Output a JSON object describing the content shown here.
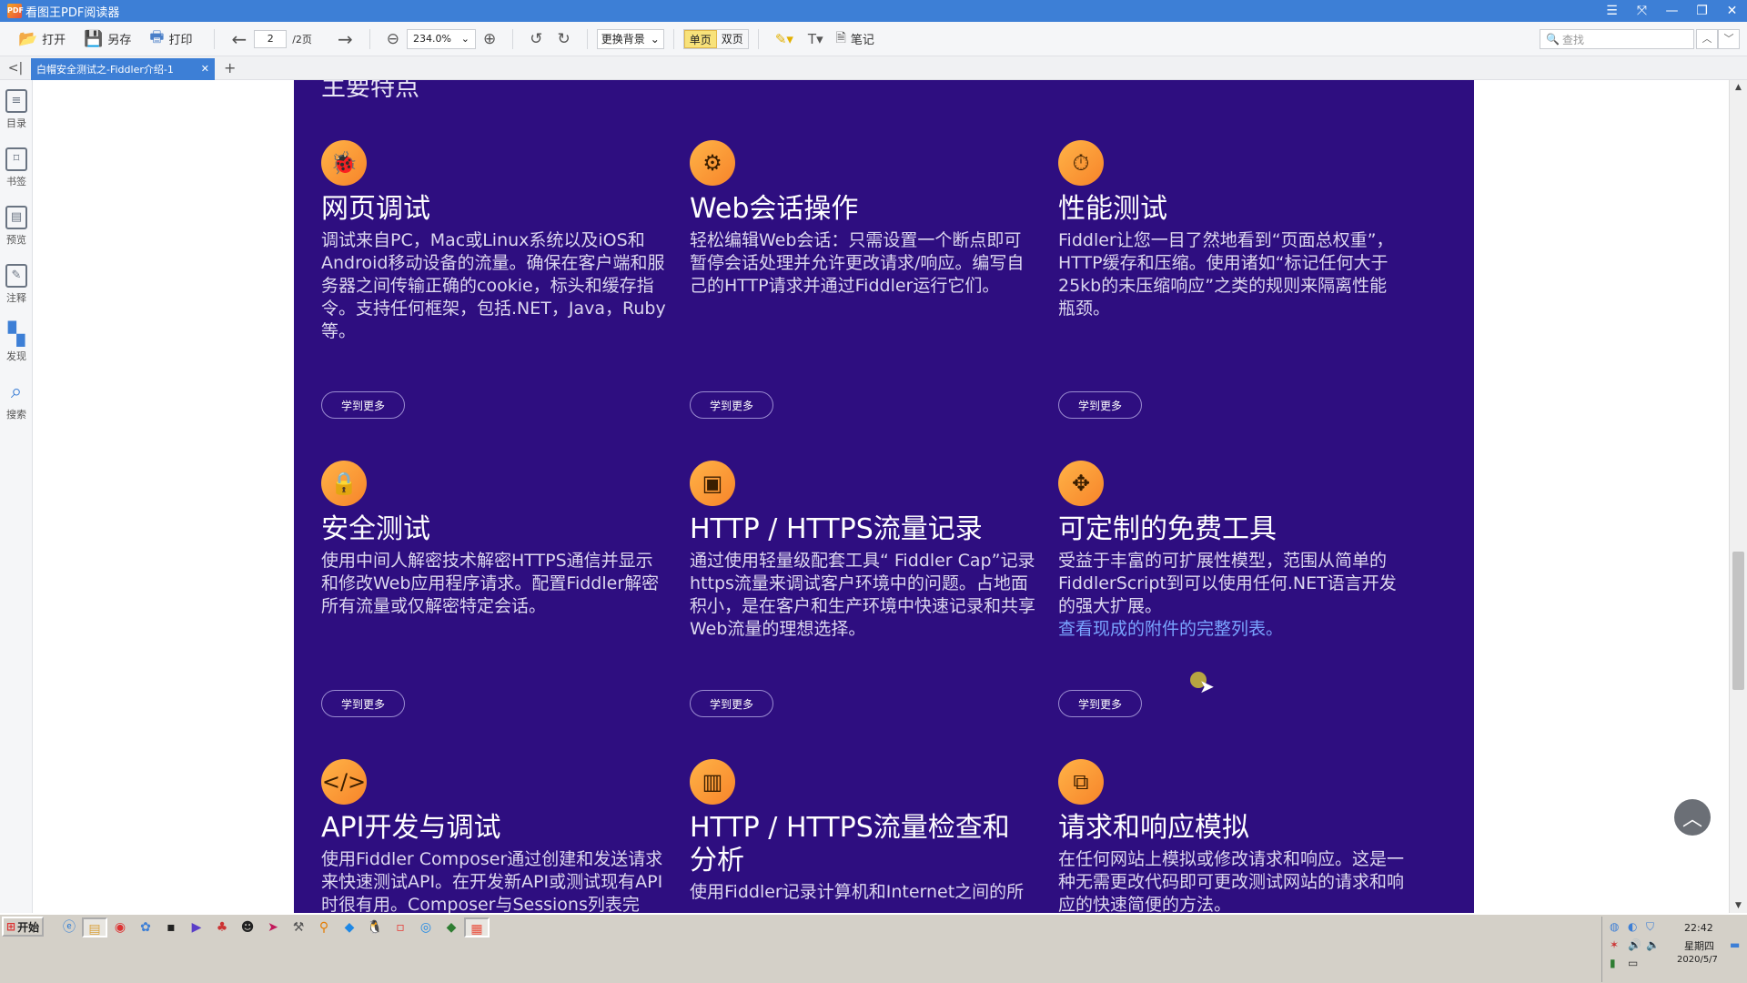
{
  "window": {
    "title": "看图王PDF阅读器",
    "app_icon": "PDF",
    "controls": [
      "menu-icon",
      "fullscreen-icon",
      "minimize-icon",
      "restore-icon",
      "close-icon"
    ]
  },
  "toolbar": {
    "open_label": "打开",
    "saveas_label": "另存",
    "print_label": "打印",
    "page_current": "2",
    "page_total": "/2页",
    "zoom_value": "234.0%",
    "background_label": "更换背景",
    "single_label": "单页",
    "double_label": "双页",
    "notes_label": "笔记",
    "search_placeholder": "查找"
  },
  "tabs": {
    "doc_tab_label": "白帽安全测试之-Fiddler介绍-1"
  },
  "sidebar": {
    "items": [
      {
        "label": "目录",
        "icon": "toc-icon"
      },
      {
        "label": "书签",
        "icon": "bookmark-icon"
      },
      {
        "label": "预览",
        "icon": "preview-icon"
      },
      {
        "label": "注释",
        "icon": "annotation-icon"
      },
      {
        "label": "发现",
        "icon": "discover-icon"
      },
      {
        "label": "搜索",
        "icon": "search-icon"
      }
    ]
  },
  "document": {
    "heading_partial": "主要特点",
    "learn_more_label": "学到更多",
    "features": [
      {
        "title": "网页调试",
        "icon": "bug-icon",
        "desc": "调试来自PC，Mac或Linux系统以及iOS和Android移动设备的流量。确保在客户端和服务器之间传输正确的cookie，标头和缓存指令。支持任何框架，包括.NET，Java，Ruby等。"
      },
      {
        "title": "Web会话操作",
        "icon": "gear-icon",
        "desc": "轻松编辑Web会话：只需设置一个断点即可暂停会话处理并允许更改请求/响应。编写自己的HTTP请求并通过Fiddler运行它们。"
      },
      {
        "title": "性能测试",
        "icon": "stopwatch-icon",
        "desc": "Fiddler让您一目了然地看到“页面总权重”，HTTP缓存和压缩。使用诸如“标记任何大于25kb的未压缩响应”之类的规则来隔离性能瓶颈。"
      },
      {
        "title": "安全测试",
        "icon": "lock-icon",
        "desc": "使用中间人解密技术解密HTTPS通信并显示和修改Web应用程序请求。配置Fiddler解密所有流量或仅解密特定会话。"
      },
      {
        "title": "HTTP / HTTPS流量记录",
        "icon": "record-icon",
        "desc": "通过使用轻量级配套工具“ Fiddler Cap”记录https流量来调试客户环境中的问题。占地面积小，是在客户和生产环境中快速记录和共享Web流量的理想选择。"
      },
      {
        "title": "可定制的免费工具",
        "icon": "customize-icon",
        "desc": "受益于丰富的可扩展性模型，范围从简单的FiddlerScript到可以使用任何.NET语言开发的强大扩展。",
        "link": "查看现成的附件的完整列表。"
      },
      {
        "title": "API开发与调试",
        "icon": "api-code-icon",
        "desc": "使用Fiddler Composer通过创建和发送请求来快速测试API。在开发新API或测试现有API时很有用。Composer与Sessions列表完"
      },
      {
        "title": "HTTP / HTTPS流量检查和分析",
        "icon": "analytics-icon",
        "desc": "使用Fiddler记录计算机和Internet之间的所"
      },
      {
        "title": "请求和响应模拟",
        "icon": "mock-icon",
        "desc": "在任何网站上模拟或修改请求和响应。这是一种无需更改代码即可更改测试网站的请求和响应的快速简便的方法。"
      }
    ]
  },
  "taskbar": {
    "start_label": "开始",
    "time": "22:42",
    "weekday": "星期四",
    "date": "2020/5/7"
  }
}
